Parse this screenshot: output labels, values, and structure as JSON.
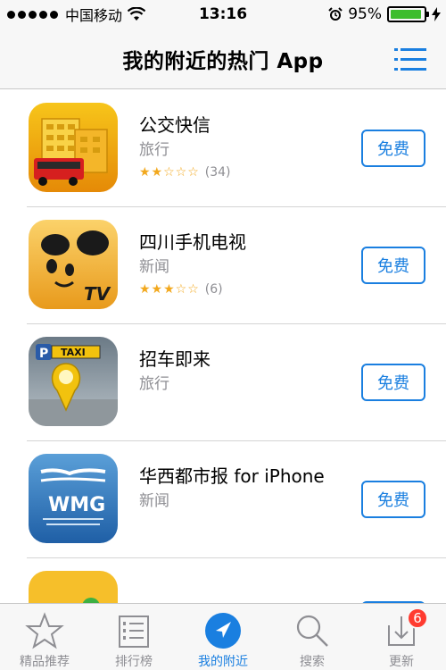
{
  "status_bar": {
    "carrier": "中国移动",
    "time": "13:16",
    "battery": "95%",
    "battery_level": 0.95
  },
  "nav": {
    "title": "我的附近的热门 App"
  },
  "apps": [
    {
      "name": "公交快信",
      "category": "旅行",
      "stars": "★★☆☆☆",
      "rating_count": "(34)",
      "button": "免费"
    },
    {
      "name": "四川手机电视",
      "category": "新闻",
      "stars": "★★★☆☆",
      "rating_count": "(6)",
      "button": "免费"
    },
    {
      "name": "招车即来",
      "category": "旅行",
      "button": "免费"
    },
    {
      "name": "华西都市报 for iPhone",
      "category": "新闻",
      "button": "免费"
    }
  ],
  "tabs": [
    {
      "label": "精品推荐",
      "icon": "star-icon"
    },
    {
      "label": "排行榜",
      "icon": "ranking-list-icon"
    },
    {
      "label": "我的附近",
      "icon": "location-arrow-icon"
    },
    {
      "label": "搜索",
      "icon": "search-icon"
    },
    {
      "label": "更新",
      "icon": "update-download-icon",
      "badge": "6"
    }
  ],
  "colors": {
    "accent": "#1a7fe0",
    "badge": "#ff3b30",
    "star": "#f2a81d"
  }
}
